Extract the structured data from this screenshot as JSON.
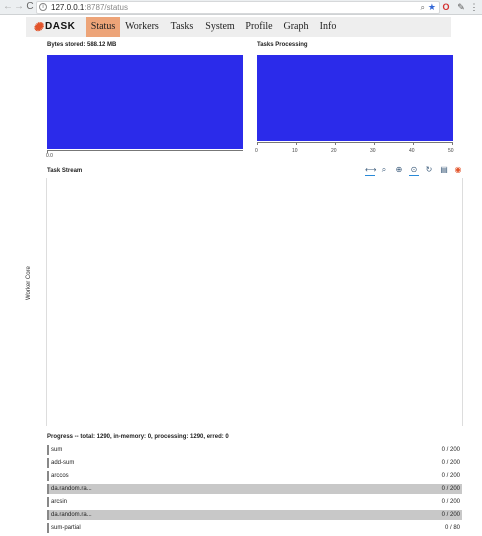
{
  "browser": {
    "url_host": "127.0.0.1",
    "url_path": ":8787/status",
    "back_icon": "←",
    "forward_icon": "→",
    "reload_icon": "C",
    "info_glyph": "i",
    "zoom_glyph": "⌕",
    "star_glyph": "★",
    "opera_glyph": "O",
    "feather_glyph": "✎",
    "menu_glyph": "⋮"
  },
  "navbar": {
    "logo_glyph": "✺",
    "logo_text": "DASK",
    "tabs": [
      {
        "label": "Status",
        "active": true
      },
      {
        "label": "Workers",
        "active": false
      },
      {
        "label": "Tasks",
        "active": false
      },
      {
        "label": "System",
        "active": false
      },
      {
        "label": "Profile",
        "active": false
      },
      {
        "label": "Graph",
        "active": false
      },
      {
        "label": "Info",
        "active": false
      }
    ],
    "active_color": "#eda478"
  },
  "bytes_stored": {
    "title": "Bytes stored: 588.12 MB",
    "tick_label": "0.0"
  },
  "tasks_processing": {
    "title": "Tasks Processing",
    "ticks": [
      "0",
      "10",
      "20",
      "30",
      "40",
      "50"
    ]
  },
  "bar_color": "#2b2bea",
  "task_stream": {
    "title": "Task Stream",
    "ylabel": "Worker Core",
    "tools": [
      {
        "name": "pan-tool-icon",
        "glyph": "⟷"
      },
      {
        "name": "box-zoom-tool-icon",
        "glyph": "⌕"
      },
      {
        "name": "wheel-zoom-tool-icon",
        "glyph": "⊕"
      },
      {
        "name": "zoom-tool-icon",
        "glyph": "⊙"
      },
      {
        "name": "reset-tool-icon",
        "glyph": "↻"
      },
      {
        "name": "hover-tool-icon",
        "glyph": "▤"
      },
      {
        "name": "bokeh-logo-icon",
        "glyph": "◉"
      }
    ]
  },
  "progress": {
    "title": "Progress -- total: 1290, in-memory: 0, processing: 1290, erred: 0",
    "rows": [
      {
        "name": "sum",
        "count": "0 / 200",
        "gray": false
      },
      {
        "name": "add-sum",
        "count": "0 / 200",
        "gray": false
      },
      {
        "name": "arccos",
        "count": "0 / 200",
        "gray": false
      },
      {
        "name": "da.random.ra...",
        "count": "0 / 200",
        "gray": true
      },
      {
        "name": "arcsin",
        "count": "0 / 200",
        "gray": false
      },
      {
        "name": "da.random.ra...",
        "count": "0 / 200",
        "gray": true
      },
      {
        "name": "sum-partial",
        "count": "0 / 80",
        "gray": false
      }
    ]
  }
}
